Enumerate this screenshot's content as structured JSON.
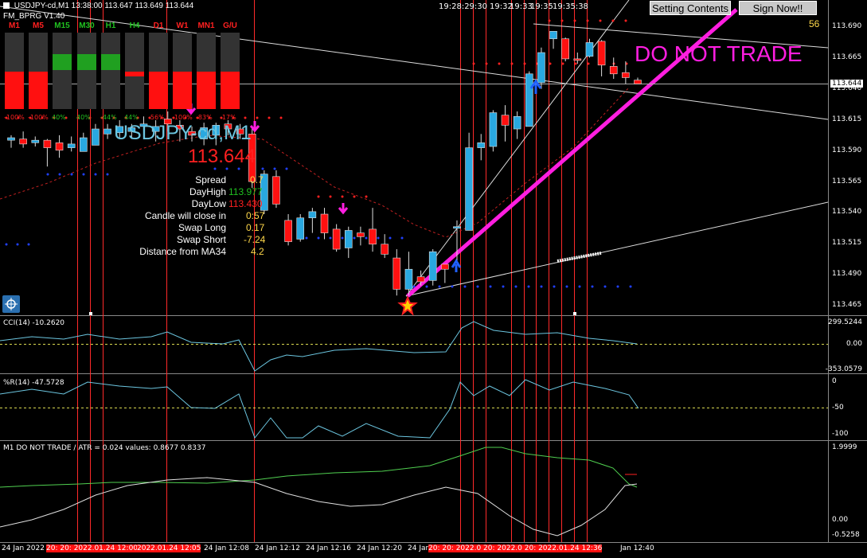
{
  "header": {
    "symbol_line": "USDJPY-cd,M1 13:38:00 113.647 113.649 113.644",
    "indicator_name": "FM_BPRG V1.40",
    "corner_number": "56"
  },
  "buttons": {
    "setting_contents": "Setting Contents",
    "sign_now": "Sign Now!!"
  },
  "warning_text": "DO NOT TRADE",
  "timeframes": {
    "labels": [
      "M1",
      "M5",
      "M15",
      "M30",
      "H1",
      "H4",
      "D1",
      "W1",
      "MN1",
      "G/U"
    ],
    "label_colors": [
      "#ff2020",
      "#ff2020",
      "#20c020",
      "#20c020",
      "#20c020",
      "#20c020",
      "#ff2020",
      "#ff2020",
      "#ff2020",
      "#ff2020"
    ],
    "states": [
      "down",
      "down",
      "up",
      "up",
      "up",
      "flat",
      "down",
      "down",
      "down",
      "down"
    ],
    "percents": [
      "-100%",
      "-100%",
      "40%",
      "40%",
      "-44%",
      "44%",
      "-56%",
      "-100%",
      "-83%",
      "-17%"
    ]
  },
  "symbol_big": "USDJPY-cd,M1",
  "price_big": "113.644",
  "info_panel": {
    "spread_label": "Spread",
    "spread_value": "0.7",
    "dayhigh_label": "DayHigh",
    "dayhigh_value": "113.977",
    "daylow_label": "DayLow",
    "daylow_value": "113.430",
    "close_label": "Candle will close in",
    "close_value": "0:57",
    "swaplong_label": "Swap Long",
    "swaplong_value": "0.17",
    "swapshort_label": "Swap Short",
    "swapshort_value": "-7.24",
    "ma_label": "Distance from MA34",
    "ma_value": "4.2"
  },
  "price_axis": {
    "labels": [
      "113.690",
      "113.665",
      "113.640",
      "113.615",
      "113.590",
      "113.565",
      "113.540",
      "113.515",
      "113.490",
      "113.465"
    ],
    "current": "113.644"
  },
  "top_times": [
    "19:28:29:30",
    "19:32",
    "19:33",
    "19:35",
    "19:35:38"
  ],
  "cci": {
    "title": "CCI(14) -10.2620",
    "axis": [
      "299.5244",
      "0.00",
      "-353.0579"
    ]
  },
  "wpr": {
    "title": "%R(14) -47.5728",
    "axis": [
      "0",
      "-50",
      "-100"
    ]
  },
  "m1": {
    "title": "M1 DO NOT TRADE  /  ATR = 0.024    values: 0.8677 0.8337",
    "axis": [
      "1.9999",
      "0.00",
      "-0.5258"
    ]
  },
  "time_axis": [
    {
      "text": "24 Jan 2022",
      "red": false
    },
    {
      "text": "20: 20: 2022.01.24 12:00",
      "red": true
    },
    {
      "text": "2022.01.24 12:05",
      "red": true
    },
    {
      "text": "24 Jan 12:08",
      "red": false
    },
    {
      "text": "24 Jan 12:12",
      "red": false
    },
    {
      "text": "24 Jan 12:16",
      "red": false
    },
    {
      "text": "24 Jan 12:20",
      "red": false
    },
    {
      "text": "24 Jan",
      "red": false
    },
    {
      "text": "20: 20: 2022.0 20: 2022.0 20: 2022.01.24 12:36",
      "red": true
    },
    {
      "text": "Jan 12:40",
      "red": false
    }
  ],
  "colors": {
    "bull": "#29a8e0",
    "bear": "#ff1010",
    "trend_magenta": "#ff1ee0",
    "vline": "#ff2a2a",
    "dots_red": "#ff2020",
    "dots_blue": "#2040ff"
  },
  "chart_data": {
    "type": "candlestick",
    "symbol": "USDJPY-cd",
    "timeframe": "M1",
    "candles": [
      {
        "o": 113.599,
        "h": 113.603,
        "l": 113.593,
        "c": 113.601
      },
      {
        "o": 113.6,
        "h": 113.606,
        "l": 113.593,
        "c": 113.596
      },
      {
        "o": 113.597,
        "h": 113.602,
        "l": 113.594,
        "c": 113.599
      },
      {
        "o": 113.599,
        "h": 113.6,
        "l": 113.578,
        "c": 113.593
      },
      {
        "o": 113.597,
        "h": 113.603,
        "l": 113.585,
        "c": 113.591
      },
      {
        "o": 113.593,
        "h": 113.602,
        "l": 113.59,
        "c": 113.596
      },
      {
        "o": 113.59,
        "h": 113.605,
        "l": 113.59,
        "c": 113.601
      },
      {
        "o": 113.595,
        "h": 113.612,
        "l": 113.595,
        "c": 113.608
      },
      {
        "o": 113.604,
        "h": 113.612,
        "l": 113.6,
        "c": 113.608
      },
      {
        "o": 113.605,
        "h": 113.615,
        "l": 113.6,
        "c": 113.61
      },
      {
        "o": 113.606,
        "h": 113.612,
        "l": 113.6,
        "c": 113.609
      },
      {
        "o": 113.61,
        "h": 113.618,
        "l": 113.603,
        "c": 113.612
      },
      {
        "o": 113.606,
        "h": 113.615,
        "l": 113.598,
        "c": 113.61
      },
      {
        "o": 113.616,
        "h": 113.622,
        "l": 113.606,
        "c": 113.612
      },
      {
        "o": 113.611,
        "h": 113.615,
        "l": 113.598,
        "c": 113.608
      },
      {
        "o": 113.606,
        "h": 113.61,
        "l": 113.598,
        "c": 113.603
      },
      {
        "o": 113.6,
        "h": 113.613,
        "l": 113.595,
        "c": 113.609
      },
      {
        "o": 113.603,
        "h": 113.613,
        "l": 113.595,
        "c": 113.611
      },
      {
        "o": 113.612,
        "h": 113.615,
        "l": 113.603,
        "c": 113.608
      },
      {
        "o": 113.608,
        "h": 113.612,
        "l": 113.6,
        "c": 113.604
      },
      {
        "o": 113.604,
        "h": 113.61,
        "l": 113.561,
        "c": 113.566
      },
      {
        "o": 113.543,
        "h": 113.575,
        "l": 113.54,
        "c": 113.572
      },
      {
        "o": 113.57,
        "h": 113.575,
        "l": 113.545,
        "c": 113.548
      },
      {
        "o": 113.535,
        "h": 113.54,
        "l": 113.515,
        "c": 113.518
      },
      {
        "o": 113.52,
        "h": 113.54,
        "l": 113.518,
        "c": 113.537
      },
      {
        "o": 113.537,
        "h": 113.545,
        "l": 113.525,
        "c": 113.542
      },
      {
        "o": 113.54,
        "h": 113.545,
        "l": 113.52,
        "c": 113.525
      },
      {
        "o": 113.528,
        "h": 113.532,
        "l": 113.51,
        "c": 113.512
      },
      {
        "o": 113.513,
        "h": 113.53,
        "l": 113.505,
        "c": 113.527
      },
      {
        "o": 113.525,
        "h": 113.53,
        "l": 113.515,
        "c": 113.522
      },
      {
        "o": 113.528,
        "h": 113.545,
        "l": 113.51,
        "c": 113.516
      },
      {
        "o": 113.516,
        "h": 113.524,
        "l": 113.505,
        "c": 113.508
      },
      {
        "o": 113.505,
        "h": 113.512,
        "l": 113.475,
        "c": 113.48
      },
      {
        "o": 113.48,
        "h": 113.51,
        "l": 113.475,
        "c": 113.496
      },
      {
        "o": 113.49,
        "h": 113.495,
        "l": 113.483,
        "c": 113.486
      },
      {
        "o": 113.487,
        "h": 113.512,
        "l": 113.483,
        "c": 113.51
      },
      {
        "o": 113.5,
        "h": 113.5,
        "l": 113.485,
        "c": 113.496
      },
      {
        "o": 113.53,
        "h": 113.535,
        "l": 113.5,
        "c": 113.53
      },
      {
        "o": 113.527,
        "h": 113.605,
        "l": 113.527,
        "c": 113.593
      },
      {
        "o": 113.593,
        "h": 113.604,
        "l": 113.583,
        "c": 113.597
      },
      {
        "o": 113.594,
        "h": 113.623,
        "l": 113.59,
        "c": 113.621
      },
      {
        "o": 113.619,
        "h": 113.627,
        "l": 113.598,
        "c": 113.611
      },
      {
        "o": 113.608,
        "h": 113.622,
        "l": 113.6,
        "c": 113.618
      },
      {
        "o": 113.61,
        "h": 113.654,
        "l": 113.61,
        "c": 113.652
      },
      {
        "o": 113.645,
        "h": 113.673,
        "l": 113.64,
        "c": 113.669
      },
      {
        "o": 113.68,
        "h": 113.686,
        "l": 113.672,
        "c": 113.686
      },
      {
        "o": 113.68,
        "h": 113.681,
        "l": 113.662,
        "c": 113.664
      },
      {
        "o": 113.664,
        "h": 113.669,
        "l": 113.66,
        "c": 113.663
      },
      {
        "o": 113.666,
        "h": 113.68,
        "l": 113.665,
        "c": 113.677
      },
      {
        "o": 113.678,
        "h": 113.679,
        "l": 113.65,
        "c": 113.659
      },
      {
        "o": 113.658,
        "h": 113.665,
        "l": 113.648,
        "c": 113.652
      },
      {
        "o": 113.653,
        "h": 113.662,
        "l": 113.644,
        "c": 113.649
      },
      {
        "o": 113.647,
        "h": 113.649,
        "l": 113.644,
        "c": 113.644
      }
    ]
  }
}
